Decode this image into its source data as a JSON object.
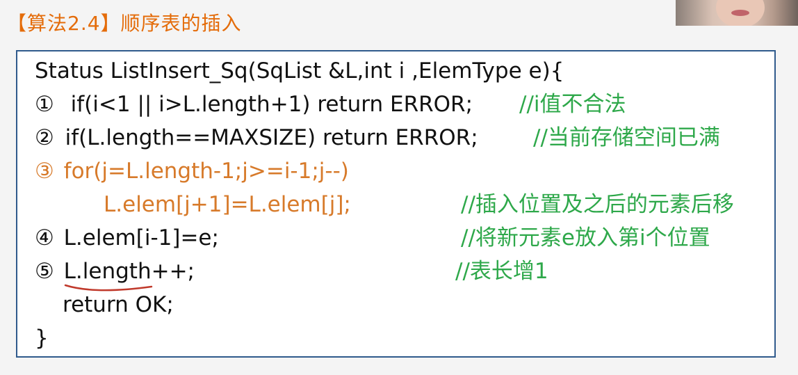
{
  "title": "【算法2.4】顺序表的插入",
  "code": {
    "signature": "Status ListInsert_Sq(SqList &L,int i ,ElemType e){",
    "lines": [
      {
        "num": "①",
        "text": "if(i<1 || i>L.length+1) return ERROR;",
        "comment": "//i值不合法"
      },
      {
        "num": "②",
        "text": "if(L.length==MAXSIZE) return ERROR;",
        "comment": "//当前存储空间已满"
      },
      {
        "num": "③",
        "text": "for(j=L.length-1;j>=i-1;j--)",
        "comment": ""
      },
      {
        "num": "",
        "text": "L.elem[j+1]=L.elem[j];",
        "comment": "//插入位置及之后的元素后移"
      },
      {
        "num": "④",
        "text": "L.elem[i-1]=e;",
        "comment": "//将新元素e放入第i个位置"
      },
      {
        "num": "⑤",
        "text": "L.length++;",
        "comment": "//表长增1"
      }
    ],
    "return_line": "return OK;",
    "close_brace": "}"
  },
  "colors": {
    "title": "#e46c0a",
    "comment": "#2ea84a",
    "highlight": "#d77a2a",
    "border": "#2f5a8c",
    "annotation": "#c0392b"
  }
}
